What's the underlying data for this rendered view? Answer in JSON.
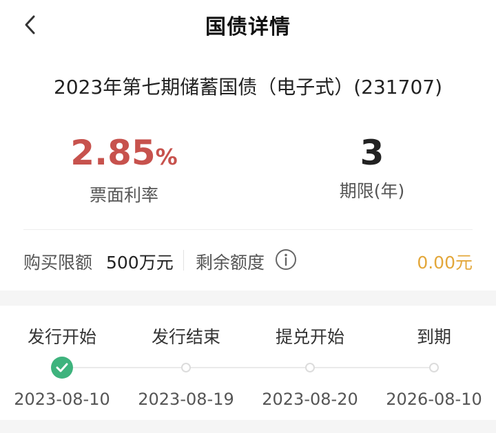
{
  "header": {
    "title": "国债详情",
    "back_icon": "chevron-left-icon"
  },
  "bond": {
    "name": "2023年第七期储蓄国债（电子式）(231707)"
  },
  "metrics": {
    "coupon_rate": {
      "value": "2.85",
      "unit": "%",
      "label": "票面利率",
      "color": "#c7524d"
    },
    "term": {
      "value": "3",
      "label": "期限(年)"
    }
  },
  "quota": {
    "purchase_limit_label": "购买限额",
    "purchase_limit_value": "500万元",
    "remaining_label": "剩余额度",
    "remaining_icon": "info-icon",
    "remaining_value": "0.00元",
    "remaining_color": "#e3a73a"
  },
  "timeline": {
    "steps": [
      {
        "label": "发行开始",
        "date": "2023-08-10",
        "status": "done"
      },
      {
        "label": "发行结束",
        "date": "2023-08-19",
        "status": "pending"
      },
      {
        "label": "提兑开始",
        "date": "2023-08-20",
        "status": "pending"
      },
      {
        "label": "到期",
        "date": "2026-08-10",
        "status": "pending"
      }
    ],
    "done_color": "#3eb37d"
  }
}
